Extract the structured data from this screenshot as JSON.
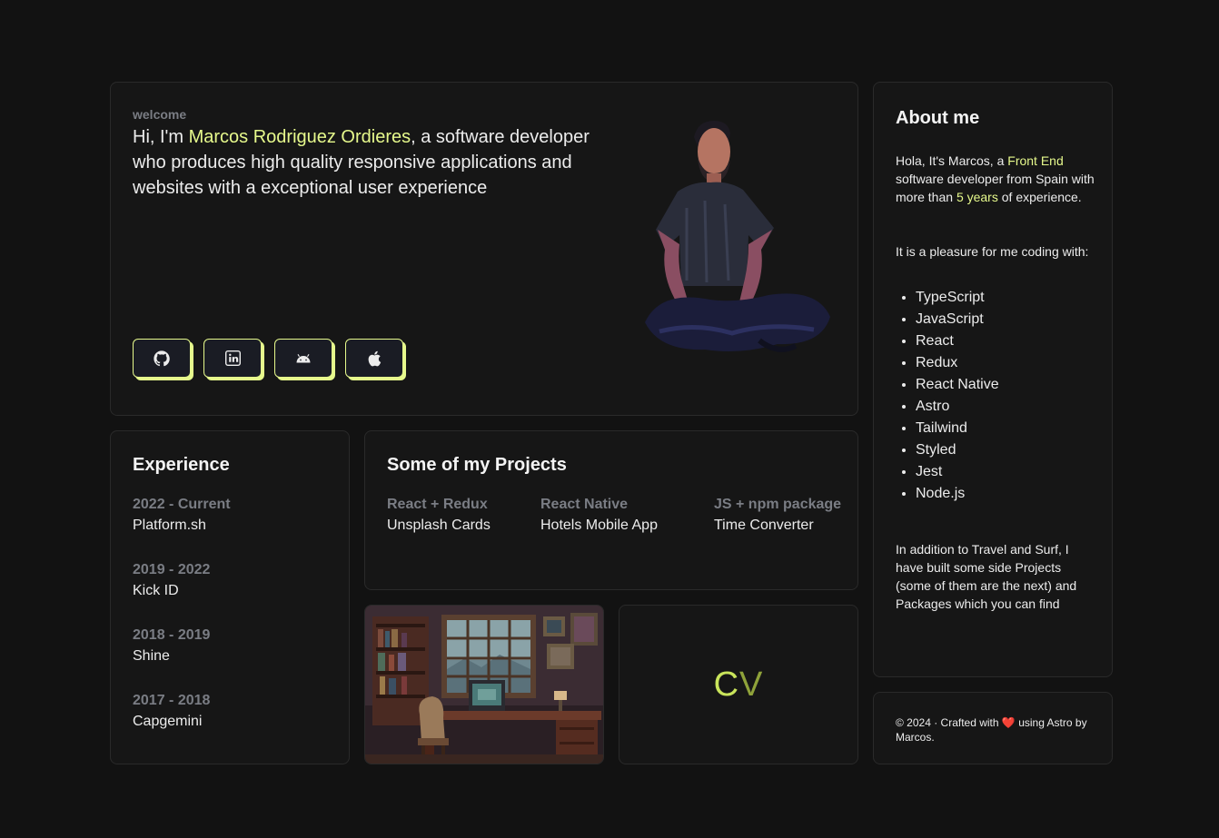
{
  "hero": {
    "welcome": "welcome",
    "greeting": "Hi, I'm ",
    "name": "Marcos Rodriguez Ordieres",
    "rest": ", a software developer who produces high quality responsive applications and websites with a exceptional user experience",
    "social_icons": [
      "github-icon",
      "linkedin-icon",
      "android-icon",
      "apple-icon"
    ]
  },
  "about": {
    "title": "About me",
    "p1_a": "Hola, It's Marcos, a ",
    "p1_b": "Front End",
    "p1_c": " software developer from Spain with more than ",
    "p1_d": "5 years",
    "p1_e": " of experience.",
    "p2": "It is a pleasure for me coding with:",
    "skills": [
      "TypeScript",
      "JavaScript",
      "React",
      "Redux",
      "React Native",
      "Astro",
      "Tailwind",
      "Styled",
      "Jest",
      "Node.js"
    ],
    "p3": "In addition to Travel and Surf, I have built some side Projects (some of them are the next) and Packages which you can find"
  },
  "footer": {
    "a": "© 2024 · Crafted with ",
    "heart": "❤️",
    "b": " using Astro by Marcos."
  },
  "experience": {
    "title": "Experience",
    "items": [
      {
        "period": "2022 - Current",
        "company": "Platform.sh"
      },
      {
        "period": "2019 - 2022",
        "company": "Kick ID"
      },
      {
        "period": "2018 - 2019",
        "company": "Shine"
      },
      {
        "period": "2017 - 2018",
        "company": "Capgemini"
      }
    ]
  },
  "projects": {
    "title": "Some of my Projects",
    "items": [
      {
        "tag": "React + Redux",
        "name": "Unsplash Cards"
      },
      {
        "tag": "React Native",
        "name": "Hotels Mobile App"
      },
      {
        "tag": "JS + npm package",
        "name": "Time Converter"
      }
    ]
  },
  "cv": {
    "c": "C",
    "v": "V"
  },
  "colors": {
    "accent": "#e6f98c",
    "background": "#121212",
    "card": "#161616",
    "muted": "#7a7d84"
  }
}
